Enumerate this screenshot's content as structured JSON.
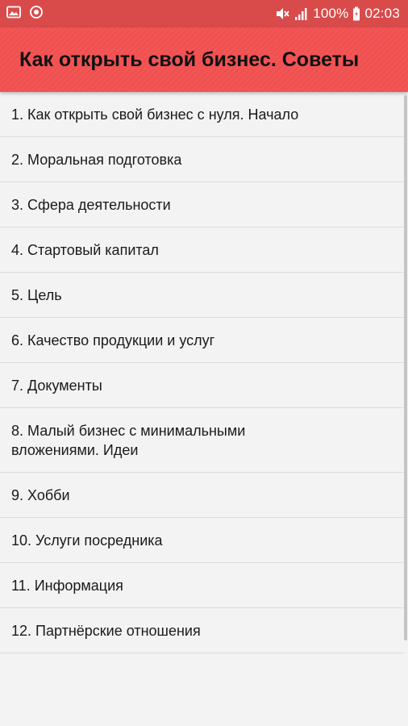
{
  "status_bar": {
    "battery_text": "100%",
    "time": "02:03",
    "icons": [
      "gallery-icon",
      "sync-icon",
      "mute-icon",
      "signal-icon",
      "battery-icon"
    ]
  },
  "app_bar": {
    "title": "Как открыть свой бизнес. Советы",
    "color": "#f45454"
  },
  "list": {
    "items": [
      {
        "label": "1. Как открыть свой бизнес с нуля. Начало"
      },
      {
        "label": "2. Моральная подготовка"
      },
      {
        "label": "3. Сфера деятельности"
      },
      {
        "label": "4. Стартовый капитал"
      },
      {
        "label": "5. Цель"
      },
      {
        "label": "6. Качество продукции и услуг"
      },
      {
        "label": "7. Документы"
      },
      {
        "label": "8. Малый бизнес с минимальными вложениями. Идеи"
      },
      {
        "label": "9. Хобби"
      },
      {
        "label": "10. Услуги посредника"
      },
      {
        "label": "11. Информация"
      },
      {
        "label": "12. Партнёрские отношения"
      }
    ]
  }
}
